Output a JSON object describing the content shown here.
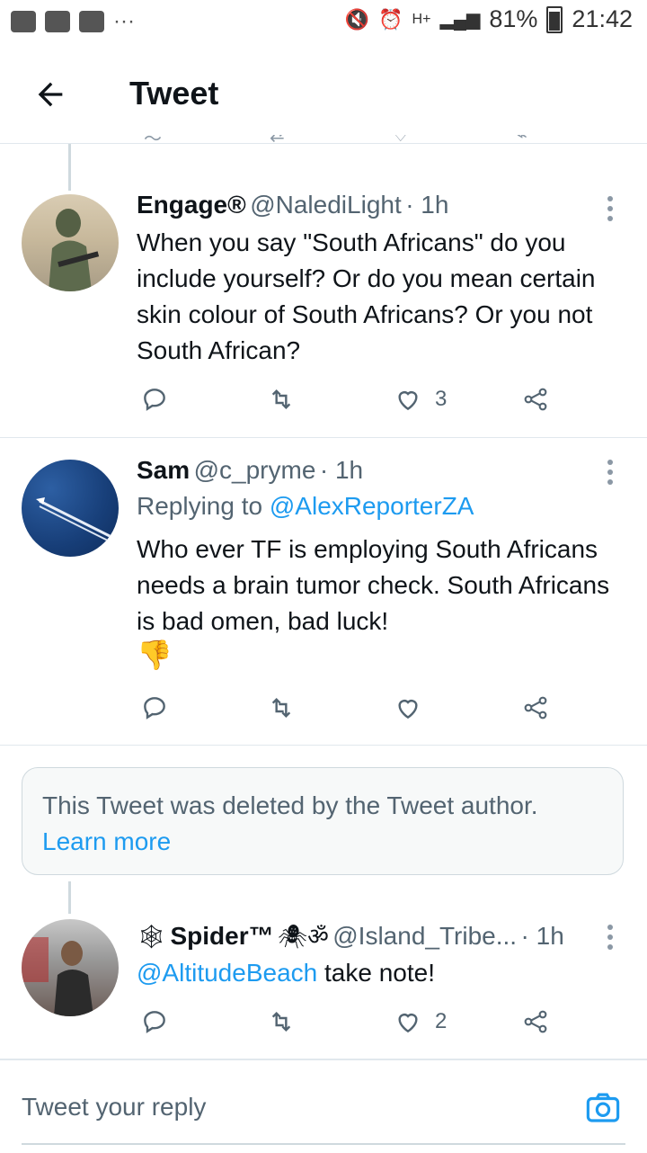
{
  "status_bar": {
    "battery": "81%",
    "time": "21:42"
  },
  "header": {
    "title": "Tweet"
  },
  "tweets": [
    {
      "name": "Engage®",
      "handle": "@NalediLight",
      "time": "· 1h",
      "text": "When you say \"South Africans\" do you include yourself? Or do you mean certain skin colour of South Africans? Or you not South African?",
      "likes": "3"
    },
    {
      "name": "Sam",
      "handle": "@c_pryme",
      "time": "· 1h",
      "replying_prefix": "Replying to",
      "replying_to": "@AlexReporterZA",
      "text": "Who ever TF is employing South Africans needs a brain tumor check. South Africans is bad omen, bad luck!",
      "emoji": "👎",
      "likes": ""
    },
    {
      "name_prefix": "🕸",
      "name": "Spider™",
      "name_suffix": "🕷ॐ",
      "handle": "@Island_Tribe...",
      "time": "· 1h",
      "mention": "@AltitudeBeach",
      "text": "take note!",
      "likes": "2"
    }
  ],
  "deleted": {
    "text": "This Tweet was deleted by the Tweet author.",
    "link": "Learn more"
  },
  "reply": {
    "placeholder": "Tweet your reply"
  },
  "colors": {
    "accent": "#1d9bf0",
    "muted": "#536471",
    "border": "#e1e8ed"
  }
}
